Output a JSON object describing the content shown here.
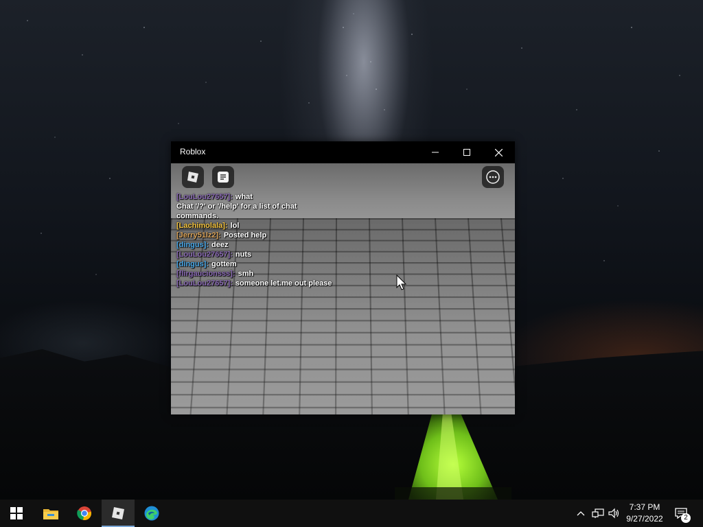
{
  "window": {
    "title": "Roblox",
    "controls": {
      "minimize": "minimize",
      "maximize": "maximize",
      "close": "close"
    }
  },
  "game": {
    "top_buttons": [
      "roblox-menu-icon",
      "chat-icon",
      "more-options-icon"
    ],
    "chat_messages": [
      {
        "name": "[LouLou27657]:",
        "text": "what",
        "color": "#8b6bb5"
      },
      {
        "name": "",
        "text": "Chat '/?' or '/help' for a list of chat commands.",
        "color": "#ffffff"
      },
      {
        "name": "[Lachimolala]:",
        "text": "lol",
        "color": "#f5c542"
      },
      {
        "name": "[Jerry51lz2]:",
        "text": "Posted help",
        "color": "#d9a35a"
      },
      {
        "name": "[dingus]:",
        "text": "deez",
        "color": "#4aa8e8"
      },
      {
        "name": "[LouLou27657]:",
        "text": "nuts",
        "color": "#8b6bb5"
      },
      {
        "name": "[dingus]:",
        "text": "gottem",
        "color": "#4aa8e8"
      },
      {
        "name": "[flirgaucionsss]:",
        "text": "smh",
        "color": "#8b6bb5"
      },
      {
        "name": "[LouLou27657]:",
        "text": "someone let.me out please",
        "color": "#8b6bb5"
      }
    ]
  },
  "taskbar": {
    "apps": [
      "windows-start-icon",
      "file-explorer-icon",
      "chrome-icon",
      "roblox-icon",
      "edge-icon"
    ],
    "active_app": "roblox-icon",
    "time": "7:37 PM",
    "date": "9/27/2022",
    "notification_count": "2"
  }
}
